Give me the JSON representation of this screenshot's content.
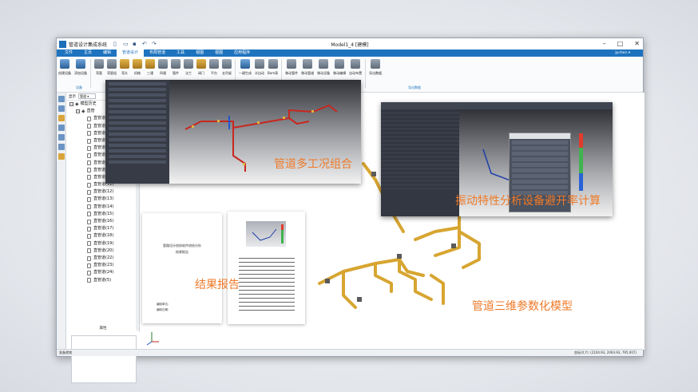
{
  "titlebar": {
    "app_name": "管道设计集成系统",
    "document_title": "Model1_4 [建模]"
  },
  "menubar": {
    "tabs": [
      "文件",
      "主页",
      "编辑",
      "管道设计",
      "布局管道",
      "工具",
      "视图",
      "视图",
      "应用程序"
    ],
    "active_tab": "管道设计",
    "user": "Jychen ▾"
  },
  "ribbon": {
    "buttons": [
      {
        "label": "创建设备",
        "icon": "equipment-icon",
        "color": "b"
      },
      {
        "label": "添加设备",
        "icon": "add-equipment-icon",
        "color": "b"
      },
      {
        "label": "弯管",
        "icon": "bend-icon",
        "color": ""
      },
      {
        "label": "弯管组",
        "icon": "bend-group-icon",
        "color": ""
      },
      {
        "label": "弯头",
        "icon": "elbow-icon",
        "color": "y"
      },
      {
        "label": "机械",
        "icon": "mechanical-icon",
        "color": "y"
      },
      {
        "label": "三通",
        "icon": "tee-icon",
        "color": "y"
      },
      {
        "label": "四通",
        "icon": "cross-icon",
        "color": ""
      },
      {
        "label": "管件",
        "icon": "fitting-icon",
        "color": ""
      },
      {
        "label": "法兰",
        "icon": "flange-icon",
        "color": ""
      },
      {
        "label": "阀门",
        "icon": "valve-icon",
        "color": "y"
      },
      {
        "label": "平台",
        "icon": "platform-icon",
        "color": ""
      },
      {
        "label": "支吊架",
        "icon": "support-icon",
        "color": ""
      },
      {
        "label": "一键生成",
        "icon": "generate-icon",
        "color": "b"
      },
      {
        "label": "半自动",
        "icon": "semi-auto-icon",
        "color": ""
      },
      {
        "label": "Bom表",
        "icon": "bom-icon",
        "color": ""
      },
      {
        "label": "移动管件",
        "icon": "move-fitting-icon",
        "color": ""
      },
      {
        "label": "移动管道",
        "icon": "move-pipe-icon",
        "color": ""
      },
      {
        "label": "移动设备",
        "icon": "move-equipment-icon",
        "color": ""
      },
      {
        "label": "移动编辑",
        "icon": "move-edit-icon",
        "color": ""
      },
      {
        "label": "自动布置",
        "icon": "auto-layout-icon",
        "color": ""
      },
      {
        "label": "导出数据",
        "icon": "export-data-icon",
        "color": ""
      }
    ],
    "group_left": "设备",
    "group_right": "导出数据"
  },
  "tree": {
    "filter_label": "显示",
    "filter_value": "管道 ▾",
    "root": "模型历史",
    "parent": "直管",
    "items": [
      "直管道",
      "直管道",
      "直管道",
      "直管道",
      "直管道",
      "直管道",
      "直管道",
      "直管道",
      "直管道",
      "直管道(11)",
      "直管道(12)",
      "直管道(13)",
      "直管道(14)",
      "直管道(15)",
      "直管道(16)",
      "直管道(17)",
      "直管道(18)",
      "直管道(19)",
      "直管道(20)",
      "直管道(22)",
      "直管道(23)",
      "直管道(24)",
      "直管道(5)"
    ],
    "props_label": "属性"
  },
  "captions": {
    "multi_case": "管道多工况组合",
    "vibration": "振动特性分析设备避开率计算",
    "report": "结果报告",
    "param_model": "管道三维参数化模型"
  },
  "report_doc": {
    "title_line1": "管路设计校核软件校核分析",
    "title_line2": "结果报告",
    "footer1": "编制单位：",
    "footer2": "编制日期："
  },
  "statusbar": {
    "left": "准备就绪",
    "coord": "坐标(X,Y): (2104.93, 2093.93, 795.007)"
  },
  "colors": {
    "ribbon_blue": "#1e73be",
    "pipe_gold": "#d7a531",
    "pipe_red": "#c8271e",
    "caption_orange": "#ee7a2a"
  }
}
